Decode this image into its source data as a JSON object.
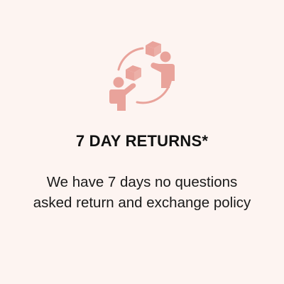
{
  "feature": {
    "icon": "exchange-returns-icon",
    "title": "7 DAY RETURNS*",
    "description": "We have 7 days no questions asked return and exchange policy"
  },
  "colors": {
    "background": "#fdf4f1",
    "icon": "#e9a39b",
    "title": "#111111",
    "text": "#1a1a1a"
  }
}
